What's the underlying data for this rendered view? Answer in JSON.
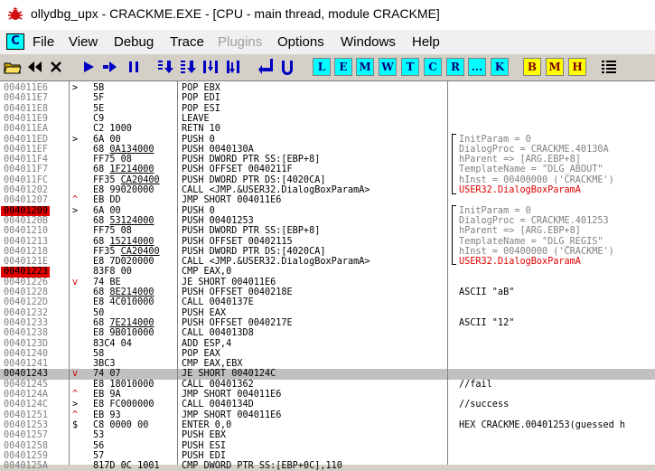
{
  "window": {
    "title": "ollydbg_upx - CRACKME.EXE - [CPU - main thread, module CRACKME]"
  },
  "menu": {
    "cpu_button": "C",
    "items": [
      "File",
      "View",
      "Debug",
      "Trace",
      "Plugins",
      "Options",
      "Windows",
      "Help"
    ],
    "disabled": [
      "Plugins"
    ]
  },
  "toolbar": {
    "buttons": [
      {
        "name": "open-icon",
        "label": ""
      },
      {
        "name": "restart-icon",
        "label": ""
      },
      {
        "name": "close-icon",
        "label": ""
      },
      {
        "name": "run-icon",
        "label": ""
      },
      {
        "name": "run-thread-icon",
        "label": ""
      },
      {
        "name": "pause-icon",
        "label": ""
      },
      {
        "name": "step-into-icon",
        "label": ""
      },
      {
        "name": "step-over-icon",
        "label": ""
      },
      {
        "name": "trace-into-icon",
        "label": ""
      },
      {
        "name": "trace-over-icon",
        "label": ""
      },
      {
        "name": "execute-till-return-icon",
        "label": ""
      },
      {
        "name": "execute-till-user-code-icon",
        "label": ""
      }
    ],
    "window_buttons": [
      "L",
      "E",
      "M",
      "W",
      "T",
      "C",
      "R",
      "...",
      "K"
    ],
    "extra_buttons": [
      "B",
      "M",
      "H"
    ]
  },
  "colors": {
    "selected_row": "#c0c0c0",
    "breakpoint": "#e00000",
    "api_call": "#e00000",
    "comment_gray": "#808080"
  },
  "disasm": [
    {
      "addr": "004011E6",
      "mark": ">",
      "hex": "5B",
      "asm": "POP EBX",
      "cmt": ""
    },
    {
      "addr": "004011E7",
      "mark": "",
      "hex": "5F",
      "asm": "POP EDI",
      "cmt": ""
    },
    {
      "addr": "004011E8",
      "mark": "",
      "hex": "5E",
      "asm": "POP ESI",
      "cmt": ""
    },
    {
      "addr": "004011E9",
      "mark": "",
      "hex": "C9",
      "asm": "LEAVE",
      "cmt": ""
    },
    {
      "addr": "004011EA",
      "mark": "",
      "hex": "C2 1000",
      "asm": "RETN 10",
      "cmt": ""
    },
    {
      "addr": "004011ED",
      "mark": ">",
      "hex": "6A 00",
      "asm": "PUSH 0",
      "cmt": "InitParam = 0",
      "cmt_style": "gray"
    },
    {
      "addr": "004011EF",
      "mark": "",
      "hex": "68 0A134000",
      "hex_u": "0A134000",
      "asm": "PUSH 0040130A",
      "cmt": "DialogProc = CRACKME.40130A",
      "cmt_style": "gray"
    },
    {
      "addr": "004011F4",
      "mark": "",
      "hex": "FF75 08",
      "asm": "PUSH DWORD PTR SS:[EBP+8]",
      "cmt": "hParent => [ARG.EBP+8]",
      "cmt_style": "gray"
    },
    {
      "addr": "004011F7",
      "mark": "",
      "hex": "68 1F214000",
      "hex_u": "1F214000",
      "asm": "PUSH OFFSET 0040211F",
      "cmt": "TemplateName = \"DLG_ABOUT\"",
      "cmt_style": "gray"
    },
    {
      "addr": "004011FC",
      "mark": "",
      "hex": "FF35 CA20400",
      "hex_u": "CA20400",
      "asm": "PUSH DWORD PTR DS:[4020CA]",
      "cmt": "hInst = 00400000 ('CRACKME')",
      "cmt_style": "gray"
    },
    {
      "addr": "00401202",
      "mark": "",
      "hex": "E8 99020000",
      "asm": "CALL <JMP.&USER32.DialogBoxParamA>",
      "cmt": "USER32.DialogBoxParamA",
      "cmt_style": "red"
    },
    {
      "addr": "00401207",
      "mark": "^",
      "mark_style": "red",
      "hex": "EB DD",
      "asm": "JMP SHORT 004011E6",
      "cmt": ""
    },
    {
      "addr": "00401209",
      "addr_hl": true,
      "mark": ">",
      "hex": "6A 00",
      "asm": "PUSH 0",
      "cmt": "InitParam = 0",
      "cmt_style": "gray"
    },
    {
      "addr": "0040120B",
      "mark": "",
      "hex": "68 53124000",
      "hex_u": "53124000",
      "asm": "PUSH 00401253",
      "cmt": "DialogProc = CRACKME.401253",
      "cmt_style": "gray"
    },
    {
      "addr": "00401210",
      "mark": "",
      "hex": "FF75 08",
      "asm": "PUSH DWORD PTR SS:[EBP+8]",
      "cmt": "hParent => [ARG.EBP+8]",
      "cmt_style": "gray"
    },
    {
      "addr": "00401213",
      "mark": "",
      "hex": "68 15214000",
      "hex_u": "15214000",
      "asm": "PUSH OFFSET 00402115",
      "cmt": "TemplateName = \"DLG_REGIS\"",
      "cmt_style": "gray"
    },
    {
      "addr": "00401218",
      "mark": "",
      "hex": "FF35 CA20400",
      "hex_u": "CA20400",
      "asm": "PUSH DWORD PTR DS:[4020CA]",
      "cmt": "hInst = 00400000 ('CRACKME')",
      "cmt_style": "gray"
    },
    {
      "addr": "0040121E",
      "mark": "",
      "hex": "E8 7D020000",
      "asm": "CALL <JMP.&USER32.DialogBoxParamA>",
      "cmt": "USER32.DialogBoxParamA",
      "cmt_style": "red"
    },
    {
      "addr": "00401223",
      "addr_hl": true,
      "mark": "",
      "hex": "83F8 00",
      "asm": "CMP EAX,0",
      "cmt": ""
    },
    {
      "addr": "00401226",
      "mark": "v",
      "mark_style": "red",
      "hex": "74 BE",
      "asm": "JE SHORT 004011E6",
      "cmt": ""
    },
    {
      "addr": "00401228",
      "mark": "",
      "hex": "68 8E214000",
      "hex_u": "8E214000",
      "asm": "PUSH OFFSET 0040218E",
      "cmt": "ASCII \"aB\""
    },
    {
      "addr": "0040122D",
      "mark": "",
      "hex": "E8 4C010000",
      "asm": "CALL 0040137E",
      "cmt": ""
    },
    {
      "addr": "00401232",
      "mark": "",
      "hex": "50",
      "asm": "PUSH EAX",
      "cmt": ""
    },
    {
      "addr": "00401233",
      "mark": "",
      "hex": "68 7E214000",
      "hex_u": "7E214000",
      "asm": "PUSH OFFSET 0040217E",
      "cmt": "ASCII \"12\""
    },
    {
      "addr": "00401238",
      "mark": "",
      "hex": "E8 9B010000",
      "asm": "CALL 004013D8",
      "cmt": ""
    },
    {
      "addr": "0040123D",
      "mark": "",
      "hex": "83C4 04",
      "asm": "ADD ESP,4",
      "cmt": ""
    },
    {
      "addr": "00401240",
      "mark": "",
      "hex": "58",
      "asm": "POP EAX",
      "cmt": ""
    },
    {
      "addr": "00401241",
      "mark": "",
      "hex": "3BC3",
      "asm": "CMP EAX,EBX",
      "cmt": ""
    },
    {
      "addr": "00401243",
      "sel": true,
      "mark": "v",
      "mark_style": "red",
      "hex": "74 07",
      "asm": "JE SHORT 0040124C",
      "cmt": ""
    },
    {
      "addr": "00401245",
      "mark": "",
      "hex": "E8 18010000",
      "asm": "CALL 00401362",
      "cmt": "//fail"
    },
    {
      "addr": "0040124A",
      "mark": "^",
      "mark_style": "red",
      "hex": "EB 9A",
      "asm": "JMP SHORT 004011E6",
      "cmt": ""
    },
    {
      "addr": "0040124C",
      "mark": ">",
      "hex": "E8 FC000000",
      "asm": "CALL 0040134D",
      "cmt": "//success"
    },
    {
      "addr": "00401251",
      "mark": "^",
      "mark_style": "red",
      "hex": "EB 93",
      "asm": "JMP SHORT 004011E6",
      "cmt": ""
    },
    {
      "addr": "00401253",
      "mark": "$",
      "hex": "C8 0000 00",
      "asm": "ENTER 0,0",
      "cmt": "HEX CRACKME.00401253(guessed h"
    },
    {
      "addr": "00401257",
      "mark": "",
      "hex": "53",
      "asm": "PUSH EBX",
      "cmt": ""
    },
    {
      "addr": "00401258",
      "mark": "",
      "hex": "56",
      "asm": "PUSH ESI",
      "cmt": ""
    },
    {
      "addr": "00401259",
      "mark": "",
      "hex": "57",
      "asm": "PUSH EDI",
      "cmt": ""
    },
    {
      "addr": "0040125A",
      "mark": "",
      "hex": "817D 0C 1001",
      "asm": "CMP DWORD PTR SS:[EBP+0C],110",
      "cmt": ""
    }
  ]
}
